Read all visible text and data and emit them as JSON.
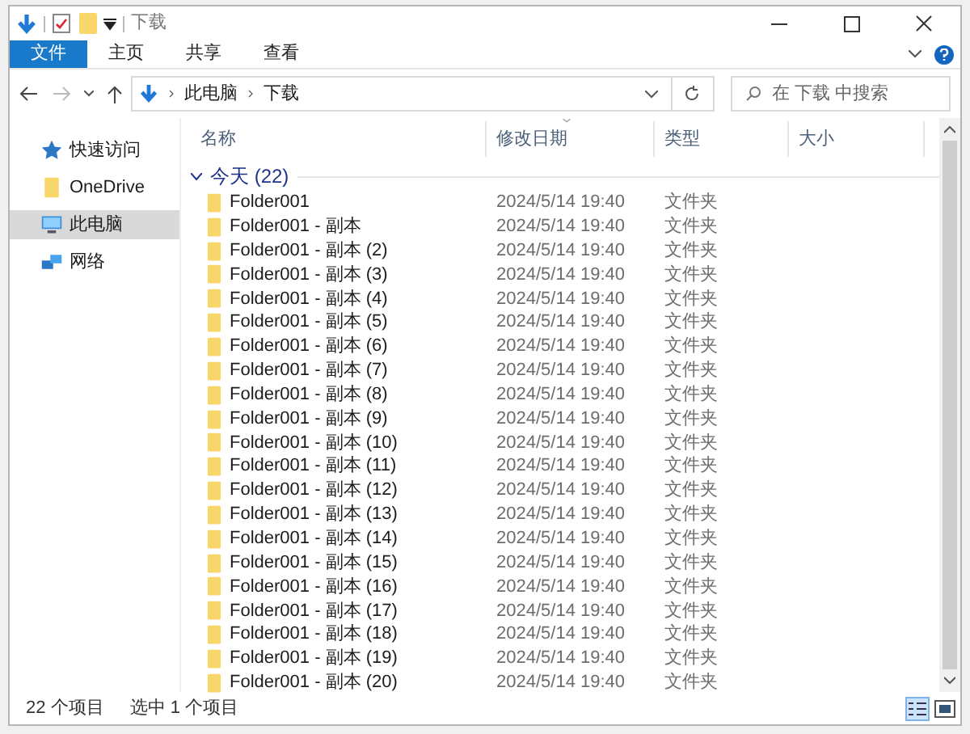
{
  "window": {
    "title": "下载"
  },
  "ribbon_tabs": [
    {
      "label": "文件",
      "selected": true
    },
    {
      "label": "主页",
      "selected": false
    },
    {
      "label": "共享",
      "selected": false
    },
    {
      "label": "查看",
      "selected": false
    }
  ],
  "address": {
    "path": [
      "此电脑",
      "下载"
    ]
  },
  "search": {
    "placeholder": "在 下载 中搜索"
  },
  "sidebar": {
    "items": [
      {
        "label": "快速访问",
        "kind": "star",
        "selected": false
      },
      {
        "label": "OneDrive",
        "kind": "folder",
        "selected": false
      },
      {
        "label": "此电脑",
        "kind": "pc",
        "selected": true
      },
      {
        "label": "网络",
        "kind": "network",
        "selected": false
      }
    ]
  },
  "table": {
    "columns": [
      "名称",
      "修改日期",
      "类型",
      "大小"
    ],
    "group": "今天 (22)",
    "rows": [
      {
        "name": "Folder001",
        "modified": "2024/5/14 19:40",
        "type": "文件夹"
      },
      {
        "name": "Folder001 - 副本",
        "modified": "2024/5/14 19:40",
        "type": "文件夹"
      },
      {
        "name": "Folder001 - 副本 (2)",
        "modified": "2024/5/14 19:40",
        "type": "文件夹"
      },
      {
        "name": "Folder001 - 副本 (3)",
        "modified": "2024/5/14 19:40",
        "type": "文件夹"
      },
      {
        "name": "Folder001 - 副本 (4)",
        "modified": "2024/5/14 19:40",
        "type": "文件夹"
      },
      {
        "name": "Folder001 - 副本 (5)",
        "modified": "2024/5/14 19:40",
        "type": "文件夹"
      },
      {
        "name": "Folder001 - 副本 (6)",
        "modified": "2024/5/14 19:40",
        "type": "文件夹"
      },
      {
        "name": "Folder001 - 副本 (7)",
        "modified": "2024/5/14 19:40",
        "type": "文件夹"
      },
      {
        "name": "Folder001 - 副本 (8)",
        "modified": "2024/5/14 19:40",
        "type": "文件夹"
      },
      {
        "name": "Folder001 - 副本 (9)",
        "modified": "2024/5/14 19:40",
        "type": "文件夹"
      },
      {
        "name": "Folder001 - 副本 (10)",
        "modified": "2024/5/14 19:40",
        "type": "文件夹"
      },
      {
        "name": "Folder001 - 副本 (11)",
        "modified": "2024/5/14 19:40",
        "type": "文件夹"
      },
      {
        "name": "Folder001 - 副本 (12)",
        "modified": "2024/5/14 19:40",
        "type": "文件夹"
      },
      {
        "name": "Folder001 - 副本 (13)",
        "modified": "2024/5/14 19:40",
        "type": "文件夹"
      },
      {
        "name": "Folder001 - 副本 (14)",
        "modified": "2024/5/14 19:40",
        "type": "文件夹"
      },
      {
        "name": "Folder001 - 副本 (15)",
        "modified": "2024/5/14 19:40",
        "type": "文件夹"
      },
      {
        "name": "Folder001 - 副本 (16)",
        "modified": "2024/5/14 19:40",
        "type": "文件夹"
      },
      {
        "name": "Folder001 - 副本 (17)",
        "modified": "2024/5/14 19:40",
        "type": "文件夹"
      },
      {
        "name": "Folder001 - 副本 (18)",
        "modified": "2024/5/14 19:40",
        "type": "文件夹"
      },
      {
        "name": "Folder001 - 副本 (19)",
        "modified": "2024/5/14 19:40",
        "type": "文件夹"
      },
      {
        "name": "Folder001 - 副本 (20)",
        "modified": "2024/5/14 19:40",
        "type": "文件夹"
      }
    ]
  },
  "status_bar": {
    "items": [
      "22 个项目",
      "选中 1 个项目"
    ]
  }
}
